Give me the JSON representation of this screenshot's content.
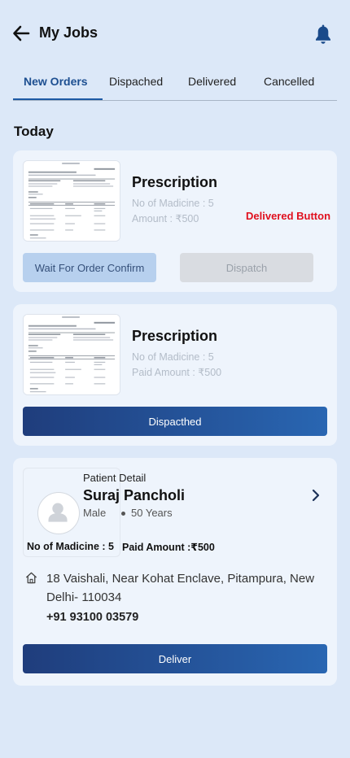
{
  "header": {
    "title": "My Jobs",
    "back_icon": "arrow-left-icon",
    "notification_icon": "bell-icon"
  },
  "tabs": [
    {
      "label": "New Orders",
      "active": true
    },
    {
      "label": "Dispached",
      "active": false
    },
    {
      "label": "Delivered",
      "active": false
    },
    {
      "label": "Cancelled",
      "active": false
    }
  ],
  "section_title": "Today",
  "orders": [
    {
      "title": "Prescription",
      "medicine_line": "No of Madicine : 5",
      "amount_line": "Amount : ₹500",
      "annotation": "Delivered Button",
      "wait_label": "Wait For Order Confirm",
      "dispatch_label": "Dispatch"
    },
    {
      "title": "Prescription",
      "medicine_line": "No of Madicine : 5",
      "amount_line": "Paid Amount : ₹500",
      "action_label": "Dispacthed"
    }
  ],
  "patient_card": {
    "detail_label": "Patient Detail",
    "name": "Suraj Pancholi",
    "gender": "Male",
    "age": "50 Years",
    "medicine_count": "No of Madicine : 5",
    "paid_amount": "Paid Amount :₹500",
    "address": "18 Vaishali, Near Kohat Enclave, Pitampura, New Delhi- 110034",
    "phone": "+91 93100 03579",
    "deliver_label": "Deliver"
  },
  "colors": {
    "background": "#dce8f8",
    "card": "#eef4fc",
    "accent": "#1d4f91",
    "button_gradient_start": "#1f3d7c",
    "button_gradient_end": "#2966b2",
    "annotation_red": "#e0101e"
  }
}
